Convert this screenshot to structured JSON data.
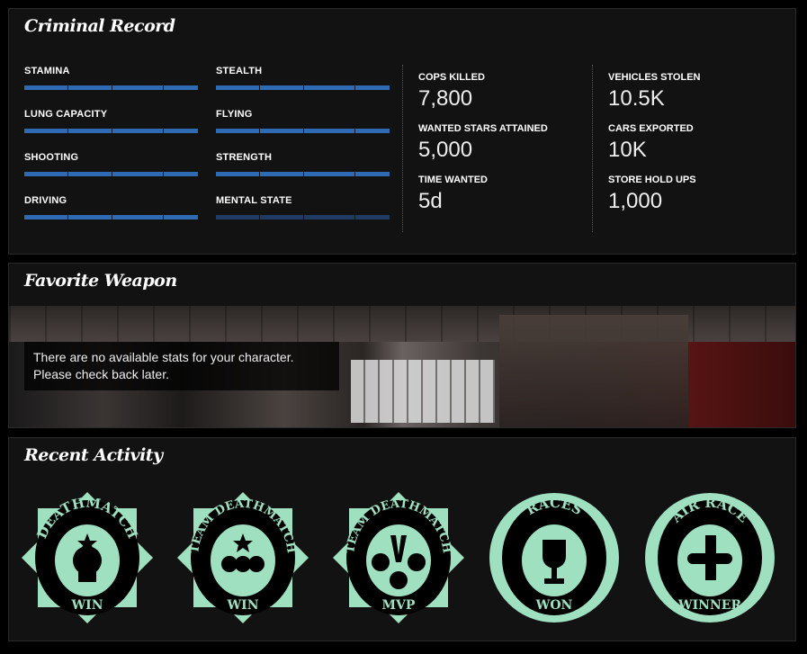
{
  "criminal_record": {
    "title": "Criminal Record",
    "skills": [
      {
        "label": "STAMINA",
        "progress": 100
      },
      {
        "label": "STEALTH",
        "progress": 100
      },
      {
        "label": "LUNG CAPACITY",
        "progress": 100
      },
      {
        "label": "FLYING",
        "progress": 100
      },
      {
        "label": "SHOOTING",
        "progress": 100
      },
      {
        "label": "STRENGTH",
        "progress": 100
      },
      {
        "label": "DRIVING",
        "progress": 100
      },
      {
        "label": "MENTAL STATE",
        "progress": 0
      }
    ],
    "stats": [
      {
        "label": "COPS KILLED",
        "value": "7,800"
      },
      {
        "label": "WANTED STARS ATTAINED",
        "value": "5,000"
      },
      {
        "label": "TIME WANTED",
        "value": "5d"
      },
      {
        "label": "VEHICLES STOLEN",
        "value": "10.5K"
      },
      {
        "label": "CARS EXPORTED",
        "value": "10K"
      },
      {
        "label": "STORE HOLD UPS",
        "value": "1,000"
      }
    ],
    "bar_color": "#2f6bb3"
  },
  "favorite_weapon": {
    "title": "Favorite Weapon",
    "message_line1": "There are no available stats for your character.",
    "message_line2": "Please check back later."
  },
  "recent_activity": {
    "title": "Recent Activity",
    "badge_color": "#9fe0c0",
    "badges": [
      {
        "top": "DEATHMATCH",
        "bottom": "WIN",
        "icon": "skull"
      },
      {
        "top": "TEAM DEATHMATCH",
        "bottom": "WIN",
        "icon": "skulls"
      },
      {
        "top": "TEAM DEATHMATCH",
        "bottom": "MVP",
        "icon": "medal"
      },
      {
        "top": "RACES",
        "bottom": "WON",
        "icon": "trophy"
      },
      {
        "top": "AIR RACE",
        "bottom": "WINNER",
        "icon": "plane"
      }
    ]
  }
}
